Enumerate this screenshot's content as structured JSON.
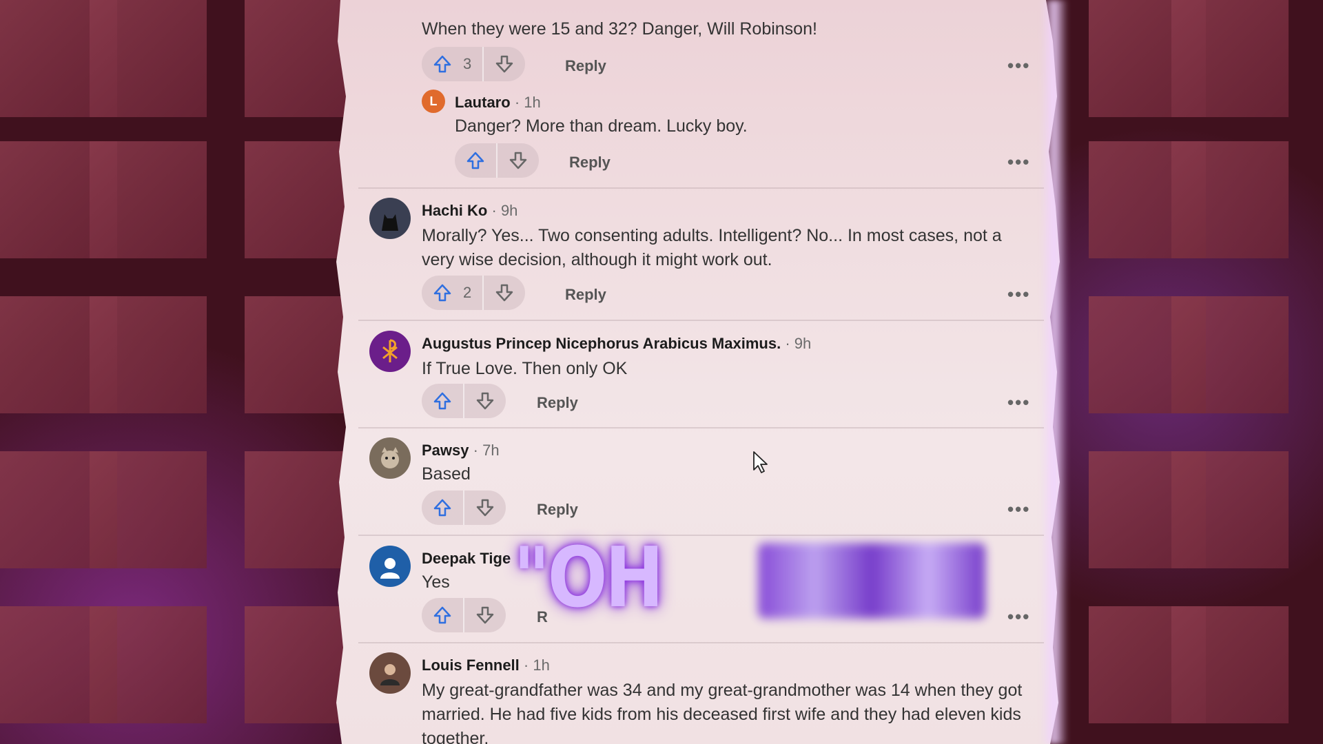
{
  "comments": [
    {
      "text": "When they were 15 and 32? Danger, Will Robinson!",
      "votes": "3",
      "reply": "Reply",
      "more": "•••"
    },
    {
      "name": "Lautaro",
      "dot": "·",
      "time": "1h",
      "avatar_initial": "L",
      "avatar_color": "#e06a2c",
      "text": "Danger? More than dream. Lucky boy.",
      "votes": "",
      "reply": "Reply",
      "more": "•••"
    },
    {
      "name": "Hachi Ko",
      "dot": "·",
      "time": "9h",
      "avatar_color": "#3a3f52",
      "text": "Morally? Yes... Two consenting adults. Intelligent? No... In most cases, not a very wise decision, although it might work out.",
      "votes": "2",
      "reply": "Reply",
      "more": "•••"
    },
    {
      "name": "Augustus Princep Nicephorus Arabicus Maximus.",
      "dot": "·",
      "time": "9h",
      "avatar_color": "#6b1e8a",
      "text": "If True Love. Then only OK",
      "votes": "",
      "reply": "Reply",
      "more": "•••"
    },
    {
      "name": "Pawsy",
      "dot": "·",
      "time": "7h",
      "avatar_color": "#7a6c5c",
      "text": "Based",
      "votes": "",
      "reply": "Reply",
      "more": "•••"
    },
    {
      "name": "Deepak Tige",
      "avatar_color": "#1f5fa8",
      "text": "Yes",
      "votes": "",
      "reply": "R",
      "more": "•••"
    },
    {
      "name": "Louis Fennell",
      "dot": "·",
      "time": "1h",
      "avatar_color": "#6b4a3e",
      "text": "My great-grandfather was 34 and my great-grandmother was 14 when they got married. He had five kids from his deceased first wife and they had eleven kids together."
    }
  ],
  "overlay": {
    "oh_text": "\"OH"
  },
  "icons": {
    "upvote": "arrow-up-icon",
    "downvote": "arrow-down-icon",
    "more": "more-options-icon",
    "cursor": "mouse-cursor-icon"
  },
  "colors": {
    "upvote": "#2f6fe0",
    "downvote": "#666666",
    "overlay_glow": "#8a2be2"
  }
}
